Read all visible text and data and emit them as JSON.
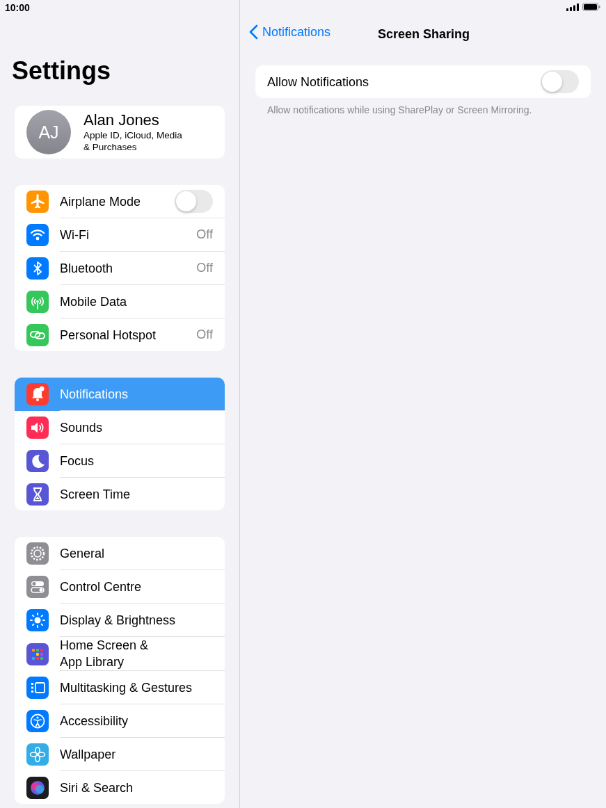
{
  "status_bar": {
    "time": "10:00"
  },
  "sidebar": {
    "title": "Settings",
    "profile": {
      "initials": "AJ",
      "name": "Alan Jones",
      "subtitle": "Apple ID, iCloud, Media\n& Purchases"
    },
    "groups": [
      [
        {
          "label": "Airplane Mode",
          "kind": "toggle",
          "on": false,
          "selected": false,
          "color": "#ff9500"
        },
        {
          "label": "Wi-Fi",
          "kind": "value",
          "value": "Off",
          "selected": false,
          "color": "#007aff"
        },
        {
          "label": "Bluetooth",
          "kind": "value",
          "value": "Off",
          "selected": false,
          "color": "#007aff"
        },
        {
          "label": "Mobile Data",
          "kind": "link",
          "selected": false,
          "color": "#34c759"
        },
        {
          "label": "Personal Hotspot",
          "kind": "value",
          "value": "Off",
          "selected": false,
          "color": "#34c759"
        }
      ],
      [
        {
          "label": "Notifications",
          "kind": "link",
          "selected": true,
          "color": "#ff3b30"
        },
        {
          "label": "Sounds",
          "kind": "link",
          "selected": false,
          "color": "#ff2d55"
        },
        {
          "label": "Focus",
          "kind": "link",
          "selected": false,
          "color": "#5856d6"
        },
        {
          "label": "Screen Time",
          "kind": "link",
          "selected": false,
          "color": "#5856d6"
        }
      ],
      [
        {
          "label": "General",
          "kind": "link",
          "selected": false,
          "color": "#8e8e93"
        },
        {
          "label": "Control Centre",
          "kind": "link",
          "selected": false,
          "color": "#8e8e93"
        },
        {
          "label": "Display & Brightness",
          "kind": "link",
          "selected": false,
          "color": "#007aff"
        },
        {
          "label": "Home Screen &\nApp Library",
          "kind": "link",
          "selected": false,
          "color": "#5856d6"
        },
        {
          "label": "Multitasking & Gestures",
          "kind": "link",
          "selected": false,
          "color": "#007aff"
        },
        {
          "label": "Accessibility",
          "kind": "link",
          "selected": false,
          "color": "#007aff"
        },
        {
          "label": "Wallpaper",
          "kind": "link",
          "selected": false,
          "color": "#32ade6"
        },
        {
          "label": "Siri & Search",
          "kind": "link",
          "selected": false,
          "color": "#1c1c1e"
        }
      ]
    ]
  },
  "detail": {
    "back_label": "Notifications",
    "title": "Screen Sharing",
    "setting": {
      "label": "Allow Notifications",
      "on": false
    },
    "footnote": "Allow notifications while using SharePlay or Screen Mirroring."
  }
}
